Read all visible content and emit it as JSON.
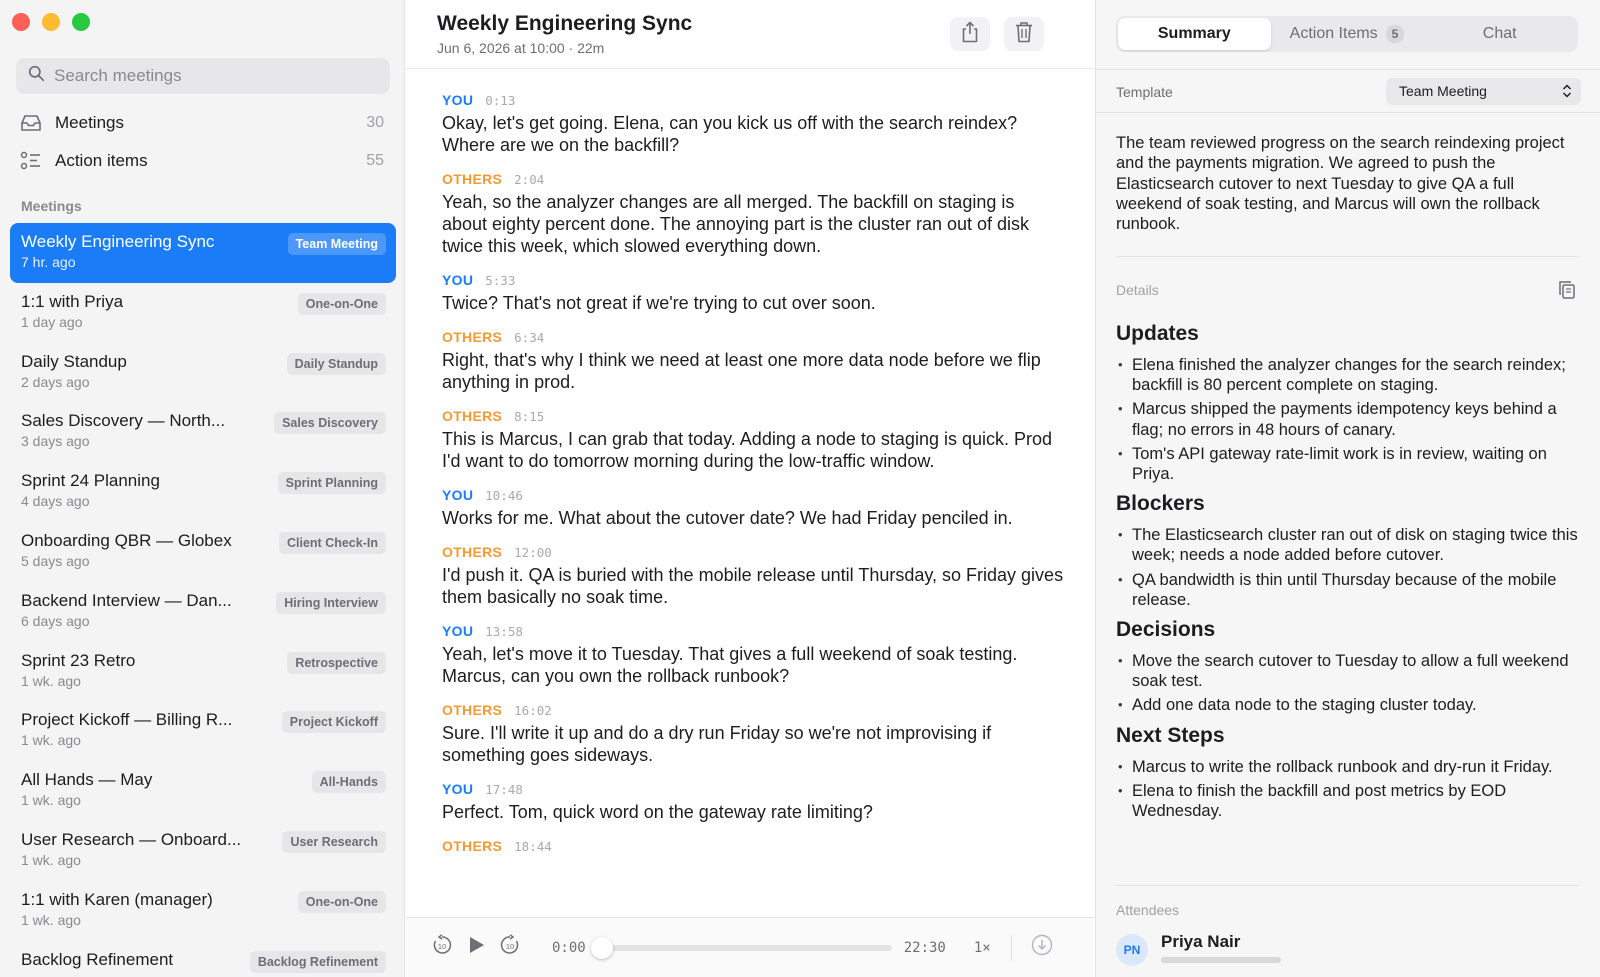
{
  "sidebar": {
    "search_placeholder": "Search meetings",
    "nav": [
      {
        "label": "Meetings",
        "count": "30",
        "icon": "tray-icon"
      },
      {
        "label": "Action items",
        "count": "55",
        "icon": "checklist-icon"
      }
    ],
    "section_label": "Meetings",
    "meetings": [
      {
        "title": "Weekly Engineering Sync",
        "sub": "7 hr. ago",
        "badge": "Team Meeting",
        "active": true
      },
      {
        "title": "1:1 with Priya",
        "sub": "1 day ago",
        "badge": "One-on-One"
      },
      {
        "title": "Daily Standup",
        "sub": "2 days ago",
        "badge": "Daily Standup"
      },
      {
        "title": "Sales Discovery — North...",
        "sub": "3 days ago",
        "badge": "Sales Discovery"
      },
      {
        "title": "Sprint 24 Planning",
        "sub": "4 days ago",
        "badge": "Sprint Planning"
      },
      {
        "title": "Onboarding QBR — Globex",
        "sub": "5 days ago",
        "badge": "Client Check-In"
      },
      {
        "title": "Backend Interview — Dan...",
        "sub": "6 days ago",
        "badge": "Hiring Interview"
      },
      {
        "title": "Sprint 23 Retro",
        "sub": "1 wk. ago",
        "badge": "Retrospective"
      },
      {
        "title": "Project Kickoff — Billing R...",
        "sub": "1 wk. ago",
        "badge": "Project Kickoff"
      },
      {
        "title": "All Hands — May",
        "sub": "1 wk. ago",
        "badge": "All-Hands"
      },
      {
        "title": "User Research — Onboard...",
        "sub": "1 wk. ago",
        "badge": "User Research"
      },
      {
        "title": "1:1 with Karen (manager)",
        "sub": "1 wk. ago",
        "badge": "One-on-One"
      },
      {
        "title": "Backlog Refinement",
        "sub": "",
        "badge": "Backlog Refinement"
      }
    ]
  },
  "header": {
    "title": "Weekly Engineering Sync",
    "subtitle": "Jun 6, 2026 at 10:00 · 22m"
  },
  "transcript": [
    {
      "speaker": "YOU",
      "time": "0:13",
      "text": "Okay, let's get going. Elena, can you kick us off with the search reindex? Where are we on the backfill?"
    },
    {
      "speaker": "OTHERS",
      "time": "2:04",
      "text": "Yeah, so the analyzer changes are all merged. The backfill on staging is about eighty percent done. The annoying part is the cluster ran out of disk twice this week, which slowed everything down."
    },
    {
      "speaker": "YOU",
      "time": "5:33",
      "text": "Twice? That's not great if we're trying to cut over soon."
    },
    {
      "speaker": "OTHERS",
      "time": "6:34",
      "text": "Right, that's why I think we need at least one more data node before we flip anything in prod."
    },
    {
      "speaker": "OTHERS",
      "time": "8:15",
      "text": "This is Marcus, I can grab that today. Adding a node to staging is quick. Prod I'd want to do tomorrow morning during the low-traffic window."
    },
    {
      "speaker": "YOU",
      "time": "10:46",
      "text": "Works for me. What about the cutover date? We had Friday penciled in."
    },
    {
      "speaker": "OTHERS",
      "time": "12:00",
      "text": "I'd push it. QA is buried with the mobile release until Thursday, so Friday gives them basically no soak time."
    },
    {
      "speaker": "YOU",
      "time": "13:58",
      "text": "Yeah, let's move it to Tuesday. That gives a full weekend of soak testing. Marcus, can you own the rollback runbook?"
    },
    {
      "speaker": "OTHERS",
      "time": "16:02",
      "text": "Sure. I'll write it up and do a dry run Friday so we're not improvising if something goes sideways."
    },
    {
      "speaker": "YOU",
      "time": "17:48",
      "text": "Perfect. Tom, quick word on the gateway rate limiting?"
    },
    {
      "speaker": "OTHERS",
      "time": "18:44",
      "text": ""
    }
  ],
  "player": {
    "current": "0:00",
    "duration": "22:30",
    "speed": "1×",
    "progress": 0.0
  },
  "rpanel": {
    "tabs": [
      {
        "label": "Summary",
        "active": true
      },
      {
        "label": "Action Items",
        "count": "5"
      },
      {
        "label": "Chat"
      }
    ],
    "template_label": "Template",
    "template_value": "Team Meeting",
    "summary": "The team reviewed progress on the search reindexing project and the payments migration. We agreed to push the Elasticsearch cutover to next Tuesday to give QA a full weekend of soak testing, and Marcus will own the rollback runbook.",
    "details_label": "Details",
    "sections": [
      {
        "heading": "Updates",
        "items": [
          "Elena finished the analyzer changes for the search reindex; backfill is 80 percent complete on staging.",
          "Marcus shipped the payments idempotency keys behind a flag; no errors in 48 hours of canary.",
          "Tom's API gateway rate-limit work is in review, waiting on Priya."
        ]
      },
      {
        "heading": "Blockers",
        "items": [
          "The Elasticsearch cluster ran out of disk on staging twice this week; needs a node added before cutover.",
          "QA bandwidth is thin until Thursday because of the mobile release."
        ]
      },
      {
        "heading": "Decisions",
        "items": [
          "Move the search cutover to Tuesday to allow a full weekend soak test.",
          "Add one data node to the staging cluster today."
        ]
      },
      {
        "heading": "Next Steps",
        "items": [
          "Marcus to write the rollback runbook and dry-run it Friday.",
          "Elena to finish the backfill and post metrics by EOD Wednesday."
        ]
      }
    ],
    "attendees_label": "Attendees",
    "attendee": {
      "initials": "PN",
      "name": "Priya Nair"
    }
  },
  "colors": {
    "accent": "#1a7cf7",
    "others": "#f29a35"
  }
}
